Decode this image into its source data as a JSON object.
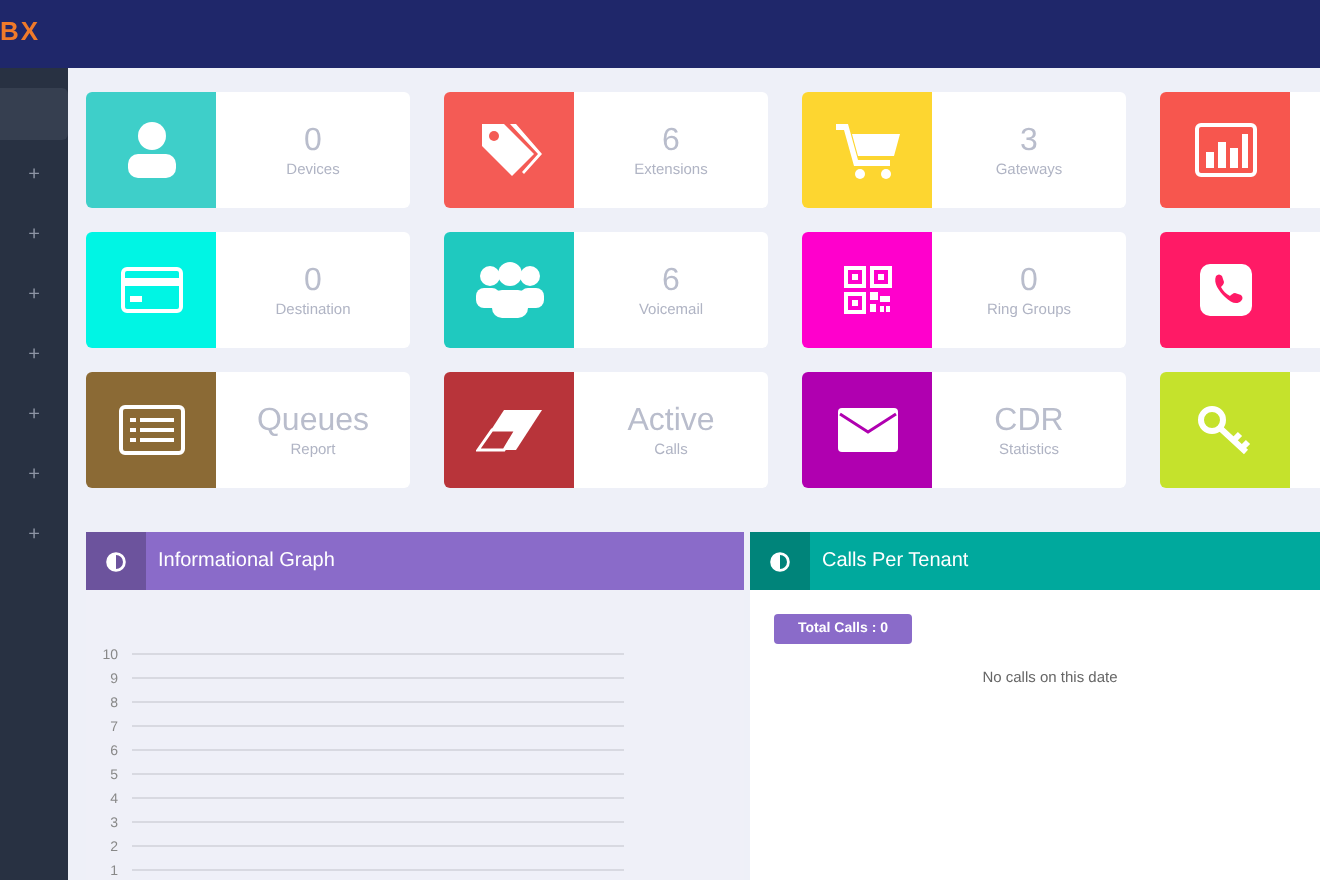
{
  "header": {
    "logo": "BX"
  },
  "sidebar": {
    "items": [
      {
        "selected": true
      },
      {
        "selected": false,
        "expander": "+"
      },
      {
        "selected": false,
        "expander": "+"
      },
      {
        "selected": false,
        "expander": "+"
      },
      {
        "selected": false,
        "expander": "+"
      },
      {
        "selected": false,
        "expander": "+"
      },
      {
        "selected": false,
        "expander": "+"
      },
      {
        "selected": false,
        "expander": "+"
      }
    ]
  },
  "cards": [
    {
      "kind": "person",
      "color": "#3ecfc9",
      "value": "0",
      "label": "Devices"
    },
    {
      "kind": "tags",
      "color": "#f45b55",
      "value": "6",
      "label": "Extensions"
    },
    {
      "kind": "cart",
      "color": "#fdd630",
      "value": "3",
      "label": "Gateways"
    },
    {
      "kind": "chart",
      "color": "#f7564e"
    },
    {
      "kind": "card",
      "color": "#00f5e4",
      "value": "0",
      "label": "Destination"
    },
    {
      "kind": "group",
      "color": "#1fc9bf",
      "value": "6",
      "label": "Voicemail"
    },
    {
      "kind": "qr",
      "color": "#ff00cc",
      "value": "0",
      "label": "Ring Groups"
    },
    {
      "kind": "phone",
      "color": "#ff1a66"
    },
    {
      "kind": "list",
      "color": "#8b6a35",
      "value": "Queues",
      "label": "Report"
    },
    {
      "kind": "eraser",
      "color": "#b8343a",
      "value": "Active",
      "label": "Calls"
    },
    {
      "kind": "envelope",
      "color": "#b000b0",
      "value": "CDR",
      "label": "Statistics"
    },
    {
      "kind": "key",
      "color": "#c5e22c"
    }
  ],
  "panels": [
    {
      "kind": "graph",
      "title": "Informational Graph",
      "color": "#8a6bc9",
      "axis_ticks": [
        "10",
        "9",
        "8",
        "7",
        "6",
        "5",
        "4",
        "3",
        "2",
        "1"
      ]
    },
    {
      "kind": "tenant",
      "title": "Calls Per Tenant",
      "color": "#00a99d",
      "button": "Total Calls : 0",
      "message": "No calls on this date"
    }
  ]
}
